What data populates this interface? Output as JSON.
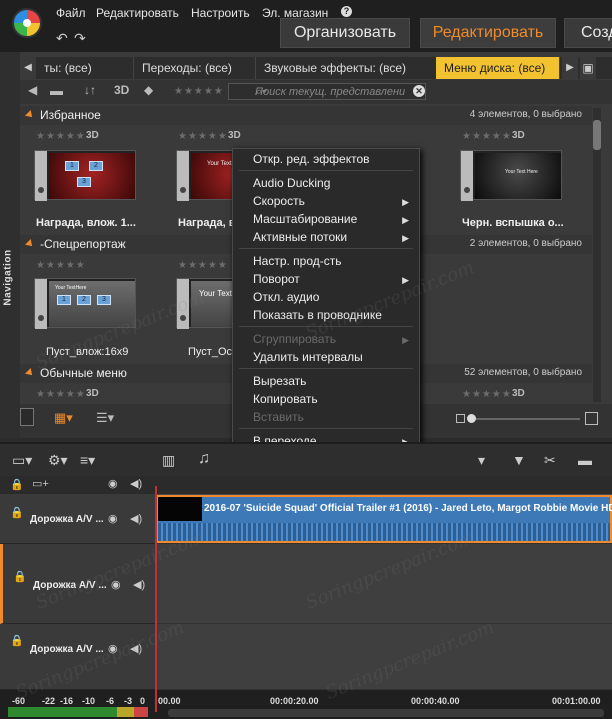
{
  "menu": {
    "file": "Файл",
    "edit": "Редактировать",
    "settings": "Настроить",
    "store": "Эл. магазин",
    "help": "?"
  },
  "modes": {
    "organize": "Организовать",
    "edit": "Редактировать",
    "create": "Созд"
  },
  "library": {
    "tabs": [
      "ты: (все)",
      "Переходы: (все)",
      "Звуковые эффекты: (все)",
      "Меню диска: (все)"
    ],
    "toolbar": {
      "view_3d": "3D",
      "search_placeholder": "Поиск текущ. представлени"
    },
    "nav_label": "Navigation",
    "sections": [
      {
        "title": "Избранное",
        "count": "4 элементов, 0 выбрано",
        "items": [
          {
            "caption": "Награда, влож. 1...",
            "badge": "3D"
          },
          {
            "caption": "Награда, влож.",
            "badge": "3D"
          },
          {
            "caption": "Черн. вспышка о...",
            "badge": "3D"
          }
        ]
      },
      {
        "title": "-Спецрепортаж",
        "count": "2 элементов, 0 выбрано",
        "items": [
          {
            "caption": "Пуст_влож:16x9",
            "badge": ""
          },
          {
            "caption": "Пуст_Ос",
            "badge": ""
          }
        ]
      },
      {
        "title": "Обычные меню",
        "count": "52 элементов, 0 выбрано",
        "items": [
          {
            "caption": "",
            "badge": "3D"
          },
          {
            "caption": "",
            "badge": "3D"
          }
        ]
      }
    ],
    "thumb_text": {
      "box1": "1",
      "box2": "2",
      "box3": "3",
      "your_text": "Your TextHere",
      "your_text2": "Your Text",
      "black_title": "Your Text Here"
    }
  },
  "context_menu": {
    "items": [
      {
        "label": "Откр. ред. эффектов",
        "disabled": false,
        "submenu": false
      },
      {
        "label": "Audio Ducking",
        "disabled": false,
        "submenu": false
      },
      {
        "label": "Скорость",
        "disabled": false,
        "submenu": true
      },
      {
        "label": "Масштабирование",
        "disabled": false,
        "submenu": true
      },
      {
        "label": "Активные потоки",
        "disabled": false,
        "submenu": true
      },
      {
        "label": "Настр. прод-сть",
        "disabled": false,
        "submenu": false
      },
      {
        "label": "Поворот",
        "disabled": false,
        "submenu": true
      },
      {
        "label": "Откл. аудио",
        "disabled": false,
        "submenu": false
      },
      {
        "label": "Показать в проводнике",
        "disabled": false,
        "submenu": false
      },
      {
        "label": "Сгруппировать",
        "disabled": true,
        "submenu": true
      },
      {
        "label": "Удалить интервалы",
        "disabled": false,
        "submenu": false
      },
      {
        "label": "Вырезать",
        "disabled": false,
        "submenu": false
      },
      {
        "label": "Копировать",
        "disabled": false,
        "submenu": false
      },
      {
        "label": "Вставить",
        "disabled": true,
        "submenu": false
      },
      {
        "label": "В переходе",
        "disabled": false,
        "submenu": true
      },
      {
        "label": "Из перехода",
        "disabled": false,
        "submenu": true
      },
      {
        "label": "Удалить",
        "disabled": false,
        "submenu": false
      },
      {
        "label": "Показать информацию",
        "disabled": false,
        "submenu": false
      }
    ]
  },
  "timeline": {
    "tracks": [
      {
        "name": "Дорожка A/V ..."
      },
      {
        "name": "Дорожка A/V ..."
      },
      {
        "name": "Дорожка A/V ..."
      }
    ],
    "clip_title": "2016-07 'Suicide Squad' Official Trailer #1 (2016) - Jared Leto, Margot Robbie Movie HD.m",
    "ruler": [
      "00.00",
      "00:00:20.00",
      "00:00:40.00",
      "00:01:00.00"
    ],
    "meter_ticks": [
      "-60",
      "-22",
      "-16",
      "-10",
      "-6",
      "-3",
      "0"
    ]
  },
  "watermark": "Soringpcrepair.com",
  "colors": {
    "accent": "#f08a2a",
    "tab_active": "#f2c230",
    "clip": "#3d79b7",
    "playhead": "#c23030"
  }
}
